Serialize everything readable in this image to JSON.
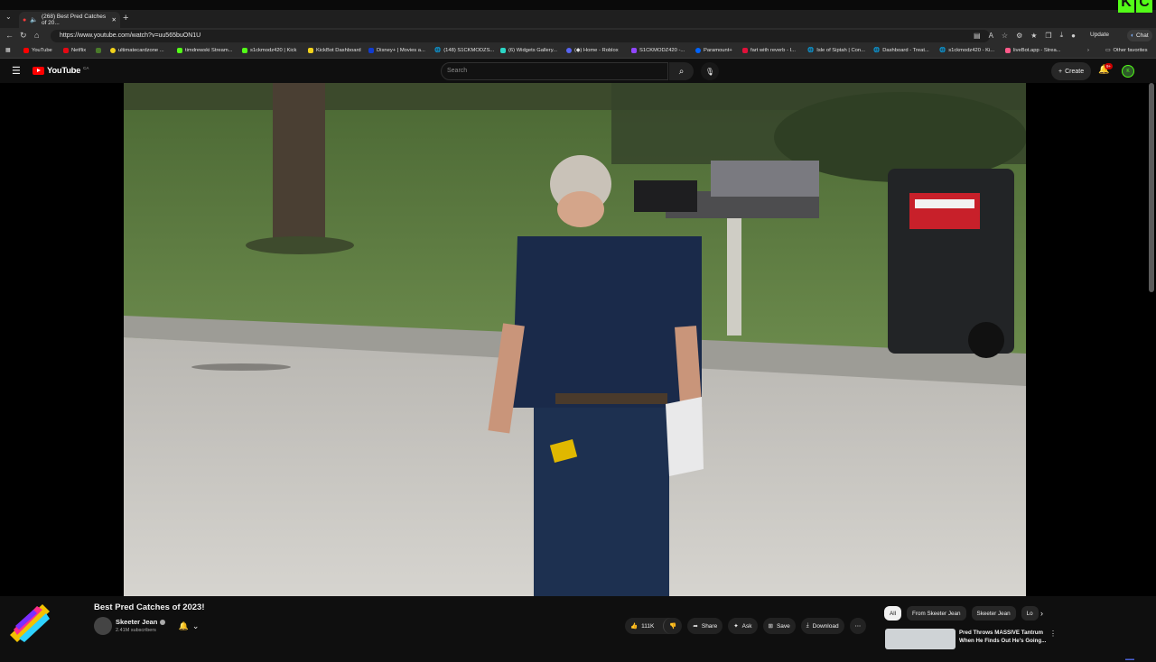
{
  "browser": {
    "tab_title": "(268) Best Pred Catches of 20...",
    "url": "https://www.youtube.com/watch?v=uu565buON1U",
    "update_label": "Update",
    "chat_label": "Chat",
    "bookmarks": [
      {
        "label": "YouTube",
        "color": "#ff0000"
      },
      {
        "label": "Netflix",
        "color": "#e50914"
      },
      {
        "label": "",
        "color": "#4a7a2a"
      },
      {
        "label": "ultimatecardzone ...",
        "color": "#f2d21b"
      },
      {
        "label": "timdrewski Stream...",
        "color": "#53fc18"
      },
      {
        "label": "s1ckmodz420 | Kick",
        "color": "#53fc18"
      },
      {
        "label": "KickBot Dashboard",
        "color": "#53fc18"
      },
      {
        "label": "Disney+ | Movies a...",
        "color": "#113ccf"
      },
      {
        "label": "(148) S1CKMODZS...",
        "color": "#888888"
      },
      {
        "label": "(6) Widgets Gallery...",
        "color": "#2bd6c6"
      },
      {
        "label": "(◆) Home - Roblox",
        "color": "#5865f2"
      },
      {
        "label": "S1CKMODZ420 -...",
        "color": "#9146ff"
      },
      {
        "label": "Paramount+",
        "color": "#0064ff"
      },
      {
        "label": "fart with reverb - I...",
        "color": "#e0113a"
      },
      {
        "label": "Isle of Siptah | Con...",
        "color": "#888888"
      },
      {
        "label": "Dashboard - Treat...",
        "color": "#888888"
      },
      {
        "label": "s1ckmodz420 - Ki...",
        "color": "#888888"
      },
      {
        "label": "liveBot.app - Strea...",
        "color": "#ff5a8a"
      }
    ],
    "other_favorites": "Other favorites"
  },
  "youtube": {
    "logo_text": "YouTube",
    "country_code": "CA",
    "search_placeholder": "Search",
    "create_label": "Create",
    "notif_count": "9+"
  },
  "video": {
    "title": "Best Pred Catches of 2023!",
    "channel": "Skeeter Jean",
    "subscribers": "2.41M subscribers",
    "likes": "111K",
    "share_label": "Share",
    "ask_label": "Ask",
    "save_label": "Save",
    "download_label": "Download"
  },
  "sidebar": {
    "chips": [
      "All",
      "From Skeeter Jean",
      "Skeeter Jean",
      "Lo"
    ],
    "recommendation_title": "Pred Throws MASSIVE Tantrum When He Finds Out He's Going..."
  },
  "colors": {
    "background": "#0f0f0f",
    "youtube_red": "#ff0000",
    "kick_green": "#53fc18"
  }
}
